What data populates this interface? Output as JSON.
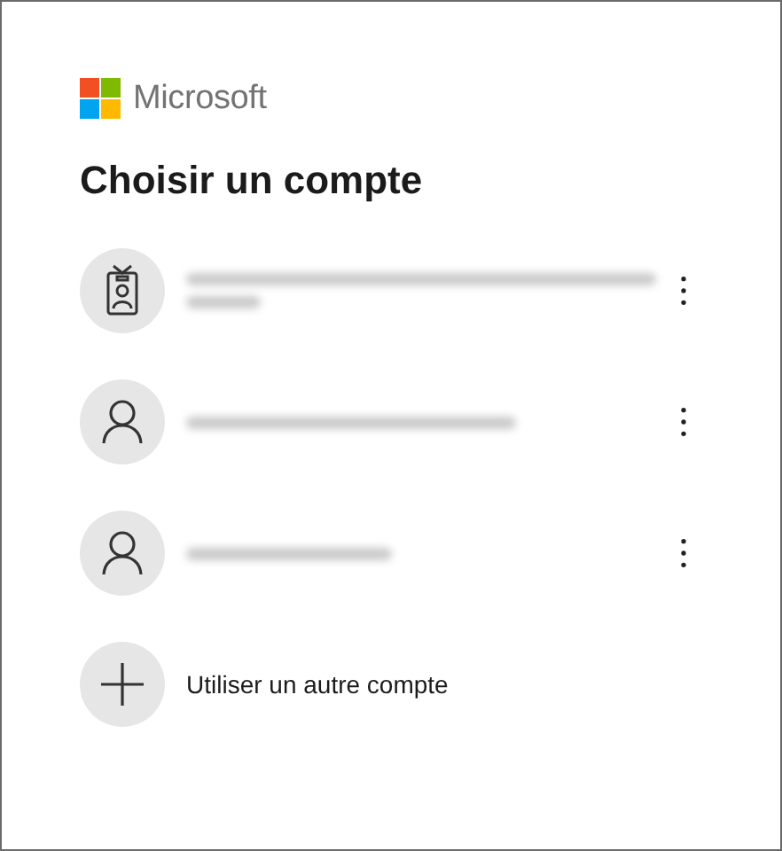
{
  "brand": {
    "name": "Microsoft"
  },
  "title": "Choisir un compte",
  "accounts": [
    {
      "kind": "work",
      "redacted": true
    },
    {
      "kind": "personal",
      "redacted": true
    },
    {
      "kind": "personal",
      "redacted": true
    }
  ],
  "add_account": {
    "label": "Utiliser un autre compte"
  }
}
